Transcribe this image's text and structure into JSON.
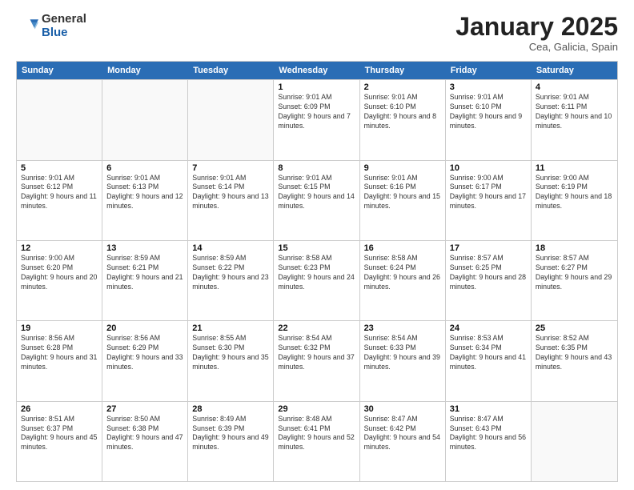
{
  "logo": {
    "general": "General",
    "blue": "Blue"
  },
  "header": {
    "month": "January 2025",
    "location": "Cea, Galicia, Spain"
  },
  "weekdays": [
    "Sunday",
    "Monday",
    "Tuesday",
    "Wednesday",
    "Thursday",
    "Friday",
    "Saturday"
  ],
  "rows": [
    [
      {
        "num": "",
        "info": ""
      },
      {
        "num": "",
        "info": ""
      },
      {
        "num": "",
        "info": ""
      },
      {
        "num": "1",
        "info": "Sunrise: 9:01 AM\nSunset: 6:09 PM\nDaylight: 9 hours and 7 minutes."
      },
      {
        "num": "2",
        "info": "Sunrise: 9:01 AM\nSunset: 6:10 PM\nDaylight: 9 hours and 8 minutes."
      },
      {
        "num": "3",
        "info": "Sunrise: 9:01 AM\nSunset: 6:10 PM\nDaylight: 9 hours and 9 minutes."
      },
      {
        "num": "4",
        "info": "Sunrise: 9:01 AM\nSunset: 6:11 PM\nDaylight: 9 hours and 10 minutes."
      }
    ],
    [
      {
        "num": "5",
        "info": "Sunrise: 9:01 AM\nSunset: 6:12 PM\nDaylight: 9 hours and 11 minutes."
      },
      {
        "num": "6",
        "info": "Sunrise: 9:01 AM\nSunset: 6:13 PM\nDaylight: 9 hours and 12 minutes."
      },
      {
        "num": "7",
        "info": "Sunrise: 9:01 AM\nSunset: 6:14 PM\nDaylight: 9 hours and 13 minutes."
      },
      {
        "num": "8",
        "info": "Sunrise: 9:01 AM\nSunset: 6:15 PM\nDaylight: 9 hours and 14 minutes."
      },
      {
        "num": "9",
        "info": "Sunrise: 9:01 AM\nSunset: 6:16 PM\nDaylight: 9 hours and 15 minutes."
      },
      {
        "num": "10",
        "info": "Sunrise: 9:00 AM\nSunset: 6:17 PM\nDaylight: 9 hours and 17 minutes."
      },
      {
        "num": "11",
        "info": "Sunrise: 9:00 AM\nSunset: 6:19 PM\nDaylight: 9 hours and 18 minutes."
      }
    ],
    [
      {
        "num": "12",
        "info": "Sunrise: 9:00 AM\nSunset: 6:20 PM\nDaylight: 9 hours and 20 minutes."
      },
      {
        "num": "13",
        "info": "Sunrise: 8:59 AM\nSunset: 6:21 PM\nDaylight: 9 hours and 21 minutes."
      },
      {
        "num": "14",
        "info": "Sunrise: 8:59 AM\nSunset: 6:22 PM\nDaylight: 9 hours and 23 minutes."
      },
      {
        "num": "15",
        "info": "Sunrise: 8:58 AM\nSunset: 6:23 PM\nDaylight: 9 hours and 24 minutes."
      },
      {
        "num": "16",
        "info": "Sunrise: 8:58 AM\nSunset: 6:24 PM\nDaylight: 9 hours and 26 minutes."
      },
      {
        "num": "17",
        "info": "Sunrise: 8:57 AM\nSunset: 6:25 PM\nDaylight: 9 hours and 28 minutes."
      },
      {
        "num": "18",
        "info": "Sunrise: 8:57 AM\nSunset: 6:27 PM\nDaylight: 9 hours and 29 minutes."
      }
    ],
    [
      {
        "num": "19",
        "info": "Sunrise: 8:56 AM\nSunset: 6:28 PM\nDaylight: 9 hours and 31 minutes."
      },
      {
        "num": "20",
        "info": "Sunrise: 8:56 AM\nSunset: 6:29 PM\nDaylight: 9 hours and 33 minutes."
      },
      {
        "num": "21",
        "info": "Sunrise: 8:55 AM\nSunset: 6:30 PM\nDaylight: 9 hours and 35 minutes."
      },
      {
        "num": "22",
        "info": "Sunrise: 8:54 AM\nSunset: 6:32 PM\nDaylight: 9 hours and 37 minutes."
      },
      {
        "num": "23",
        "info": "Sunrise: 8:54 AM\nSunset: 6:33 PM\nDaylight: 9 hours and 39 minutes."
      },
      {
        "num": "24",
        "info": "Sunrise: 8:53 AM\nSunset: 6:34 PM\nDaylight: 9 hours and 41 minutes."
      },
      {
        "num": "25",
        "info": "Sunrise: 8:52 AM\nSunset: 6:35 PM\nDaylight: 9 hours and 43 minutes."
      }
    ],
    [
      {
        "num": "26",
        "info": "Sunrise: 8:51 AM\nSunset: 6:37 PM\nDaylight: 9 hours and 45 minutes."
      },
      {
        "num": "27",
        "info": "Sunrise: 8:50 AM\nSunset: 6:38 PM\nDaylight: 9 hours and 47 minutes."
      },
      {
        "num": "28",
        "info": "Sunrise: 8:49 AM\nSunset: 6:39 PM\nDaylight: 9 hours and 49 minutes."
      },
      {
        "num": "29",
        "info": "Sunrise: 8:48 AM\nSunset: 6:41 PM\nDaylight: 9 hours and 52 minutes."
      },
      {
        "num": "30",
        "info": "Sunrise: 8:47 AM\nSunset: 6:42 PM\nDaylight: 9 hours and 54 minutes."
      },
      {
        "num": "31",
        "info": "Sunrise: 8:47 AM\nSunset: 6:43 PM\nDaylight: 9 hours and 56 minutes."
      },
      {
        "num": "",
        "info": ""
      }
    ]
  ]
}
